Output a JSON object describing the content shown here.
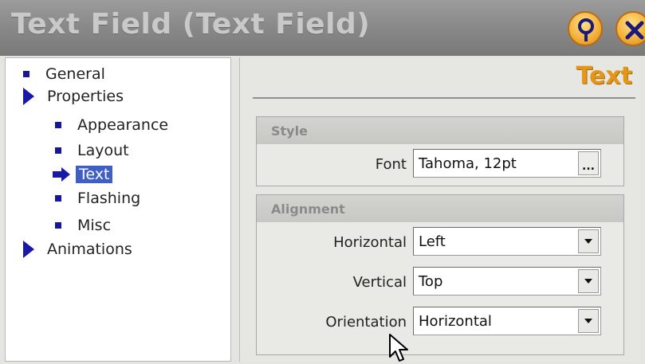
{
  "window": {
    "title": "Text Field (Text Field)"
  },
  "titlebar": {
    "help_icon": "help-pin-icon",
    "close_icon": "close-x-icon",
    "accent_color": "#f4b33d"
  },
  "tree": {
    "items": [
      {
        "label": "General",
        "level": 0,
        "icon": "square-bullet",
        "selected": false
      },
      {
        "label": "Properties",
        "level": 0,
        "icon": "expand-triangle",
        "selected": false
      },
      {
        "label": "Appearance",
        "level": 1,
        "icon": "square-bullet",
        "selected": false
      },
      {
        "label": "Layout",
        "level": 1,
        "icon": "square-bullet",
        "selected": false
      },
      {
        "label": "Text",
        "level": 1,
        "icon": "arrow-right",
        "selected": true
      },
      {
        "label": "Flashing",
        "level": 1,
        "icon": "square-bullet",
        "selected": false
      },
      {
        "label": "Misc",
        "level": 1,
        "icon": "square-bullet",
        "selected": false
      },
      {
        "label": "Animations",
        "level": 0,
        "icon": "expand-triangle",
        "selected": false
      }
    ]
  },
  "panel": {
    "header": "Text",
    "header_color": "#e49619",
    "style_group": {
      "title": "Style",
      "font_label": "Font",
      "font_value": "Tahoma, 12pt",
      "browse_label": "..."
    },
    "alignment_group": {
      "title": "Alignment",
      "horizontal_label": "Horizontal",
      "horizontal_value": "Left",
      "vertical_label": "Vertical",
      "vertical_value": "Top",
      "orientation_label": "Orientation",
      "orientation_value": "Horizontal"
    }
  }
}
